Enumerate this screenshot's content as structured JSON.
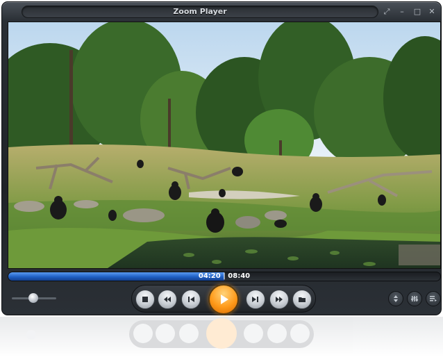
{
  "window": {
    "title": "Zoom Player"
  },
  "titlebar_buttons": [
    {
      "name": "fullscreen-icon",
      "glyph": "⤢"
    },
    {
      "name": "minimize-icon",
      "glyph": "–"
    },
    {
      "name": "maximize-icon",
      "glyph": "□"
    },
    {
      "name": "close-icon",
      "glyph": "✕"
    }
  ],
  "video": {
    "scene": "gorillas-in-grass-enclosure"
  },
  "playback": {
    "current_time": "04:20",
    "duration": "08:40",
    "time_display": "04:20 | 08:40",
    "progress_fraction": 0.5,
    "volume_fraction": 0.5
  },
  "transport_buttons": [
    {
      "name": "stop-icon"
    },
    {
      "name": "rewind-icon"
    },
    {
      "name": "previous-chapter-icon"
    },
    {
      "name": "play-icon"
    },
    {
      "name": "next-chapter-icon"
    },
    {
      "name": "fast-forward-icon"
    },
    {
      "name": "open-file-icon"
    }
  ],
  "side_buttons": [
    {
      "name": "navigator-icon"
    },
    {
      "name": "equalizer-icon"
    },
    {
      "name": "playlist-icon"
    }
  ],
  "colors": {
    "accent_play": "#ff9a1a",
    "seek_fill": "#1f5fc4",
    "chrome_dark": "#1f2328"
  }
}
